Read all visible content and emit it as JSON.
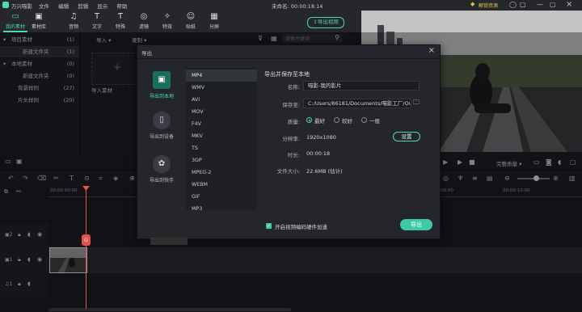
{
  "titlebar": {
    "app_name": "万兴喵影",
    "menu": [
      "文件",
      "编辑",
      "剪辑",
      "显示",
      "帮助"
    ],
    "project_title": "未命名: 00:00:18:14",
    "unlock_label": "解锁资源"
  },
  "toolbar": {
    "items": [
      {
        "label": "我的素材",
        "icon": "▭"
      },
      {
        "label": "素材库",
        "icon": "▣"
      },
      {
        "label": "音频",
        "icon": "♫"
      },
      {
        "label": "文字",
        "icon": "T"
      },
      {
        "label": "特殊",
        "icon": "Ƭ"
      },
      {
        "label": "滤镜",
        "icon": "◎"
      },
      {
        "label": "特效",
        "icon": "✧"
      },
      {
        "label": "贴纸",
        "icon": "☺"
      },
      {
        "label": "分屏",
        "icon": "▦"
      }
    ],
    "export_label": "导出视频"
  },
  "left_panel": {
    "items": [
      {
        "label": "项目素材",
        "count": "(1)",
        "arrow": "▾"
      },
      {
        "label": "新建文件夹",
        "count": "(1)",
        "arrow": ""
      },
      {
        "label": "本地素材",
        "count": "(0)",
        "arrow": "▾"
      },
      {
        "label": "新建文件夹",
        "count": "(0)",
        "arrow": ""
      },
      {
        "label": "背景样例",
        "count": "(27)",
        "arrow": ""
      },
      {
        "label": "片头样例",
        "count": "(20)",
        "arrow": ""
      }
    ]
  },
  "media_panel": {
    "import_label": "导入",
    "record_label": "录制",
    "search_placeholder": "搜索关键词",
    "import_tile_label": "导入素材"
  },
  "dialog": {
    "title": "导出",
    "side_options": [
      {
        "label": "导出到本地",
        "icon": "▣"
      },
      {
        "label": "导出到设备",
        "icon": "▯"
      },
      {
        "label": "导出到快手",
        "icon": "✿"
      }
    ],
    "formats": [
      "MP4",
      "WMV",
      "AVI",
      "MOV",
      "F4V",
      "MKV",
      "TS",
      "3GP",
      "MPEG-2",
      "WEBM",
      "GIF",
      "MP3"
    ],
    "section_title": "导出并保存至本地",
    "name_label": "名称:",
    "name_value": "喵影-我的影片",
    "path_label": "保存至:",
    "path_value": "C:/Users/86181/Documents/喵影工厂/Outp",
    "quality_label": "质量:",
    "quality_options": [
      "最好",
      "较好",
      "一般"
    ],
    "resolution_label": "分辨率:",
    "resolution_value": "1920x1080",
    "settings_label": "设置",
    "duration_label": "时长:",
    "duration_value": "00:00:18",
    "size_label": "文件大小:",
    "size_value": "22.6MB (估计)",
    "hw_accel_label": "开启视频编码硬件加速",
    "export_button": "导出",
    "close_icon": "×"
  },
  "player": {
    "quality_label": "完整质量"
  },
  "timeline": {
    "start_time": "00:00:00:00",
    "right_time": "00:00",
    "right_time2": "00:00:10:00",
    "playhead_label": "⊙"
  },
  "colors": {
    "accent": "#3ec9a7",
    "dialog_bg": "#25262c",
    "playhead": "#e0524a"
  }
}
